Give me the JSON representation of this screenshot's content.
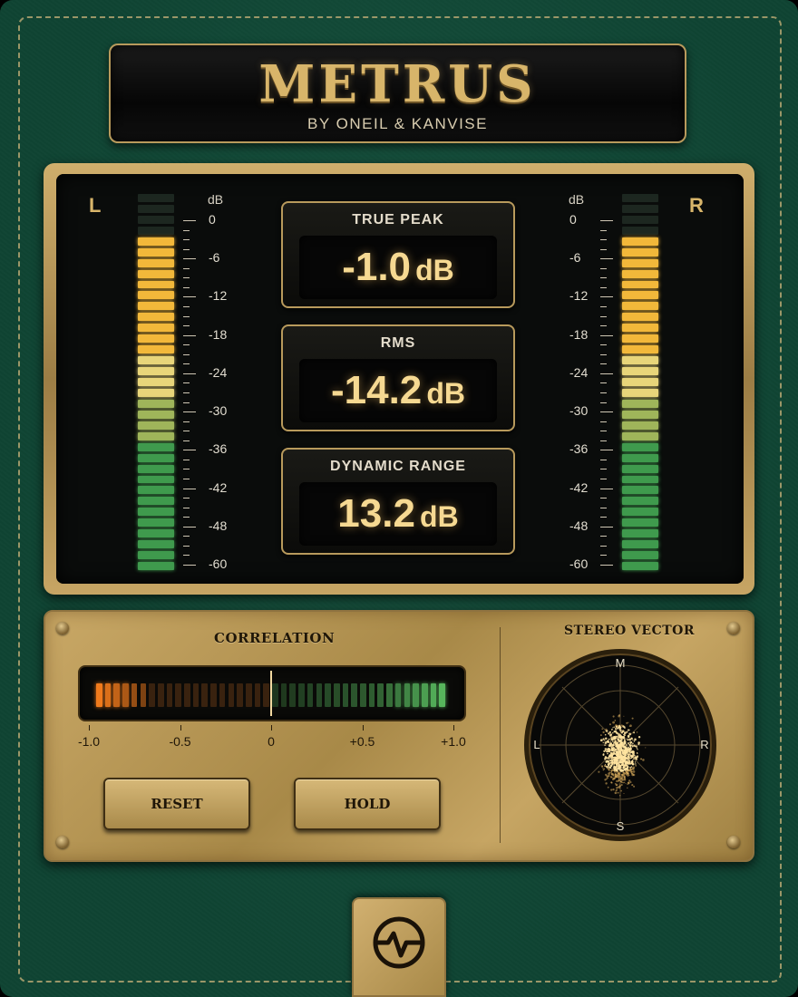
{
  "header": {
    "title": "METRUS",
    "subtitle": "BY ONEIL & KANVISE"
  },
  "meters": {
    "left": {
      "label": "L",
      "unit": "dB",
      "lit_segments": 31,
      "total_segments": 35
    },
    "right": {
      "label": "R",
      "unit": "dB",
      "lit_segments": 31,
      "total_segments": 35
    },
    "scale": [
      "0",
      "-6",
      "-12",
      "-18",
      "-24",
      "-30",
      "-36",
      "-42",
      "-48",
      "-60"
    ]
  },
  "readouts": {
    "true_peak": {
      "label": "TRUE PEAK",
      "value": "-1.0",
      "unit": "dB"
    },
    "rms": {
      "label": "RMS",
      "value": "-14.2",
      "unit": "dB"
    },
    "dynamic_range": {
      "label": "DYNAMIC RANGE",
      "value": "13.2",
      "unit": "dB"
    }
  },
  "correlation": {
    "title": "CORRELATION",
    "scale": [
      "-1.0",
      "-0.5",
      "0",
      "+0.5",
      "+1.0"
    ],
    "segments": 40
  },
  "buttons": {
    "reset": "RESET",
    "hold": "HOLD"
  },
  "stereo_vector": {
    "title": "STEREO VECTOR",
    "top": "M",
    "bottom": "S",
    "left": "L",
    "right": "R"
  },
  "colors": {
    "green_leather": "#0f4433",
    "brass": "#c9a866",
    "amber": "#f6d992",
    "meter_green": "#3f9a4d",
    "meter_yellow": "#f2b83a",
    "meter_orange": "#f07a1c"
  }
}
